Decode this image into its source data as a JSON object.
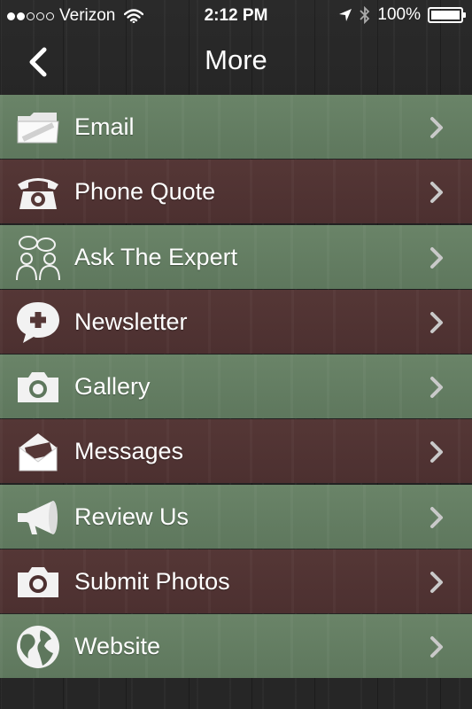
{
  "status_bar": {
    "carrier": "Verizon",
    "time": "2:12 PM",
    "battery": "100%",
    "signal_bars_filled": 2,
    "signal_bars_total": 5
  },
  "nav": {
    "title": "More",
    "back_icon": "chevron-left-icon"
  },
  "colors": {
    "row_green": "#6a8468",
    "row_brown": "#553736",
    "text": "#ffffff",
    "chevron": "#c9c9c9"
  },
  "menu": [
    {
      "label": "Email",
      "icon": "folder-icon",
      "style": "green"
    },
    {
      "label": "Phone Quote",
      "icon": "telephone-icon",
      "style": "brown"
    },
    {
      "label": "Ask The Expert",
      "icon": "people-chat-icon",
      "style": "green"
    },
    {
      "label": "Newsletter",
      "icon": "speech-bubble-plus-icon",
      "style": "brown"
    },
    {
      "label": "Gallery",
      "icon": "camera-icon",
      "style": "green"
    },
    {
      "label": "Messages",
      "icon": "envelope-open-icon",
      "style": "brown"
    },
    {
      "label": "Review Us",
      "icon": "megaphone-icon",
      "style": "green"
    },
    {
      "label": "Submit Photos",
      "icon": "camera-icon",
      "style": "brown"
    },
    {
      "label": "Website",
      "icon": "globe-icon",
      "style": "green"
    }
  ]
}
